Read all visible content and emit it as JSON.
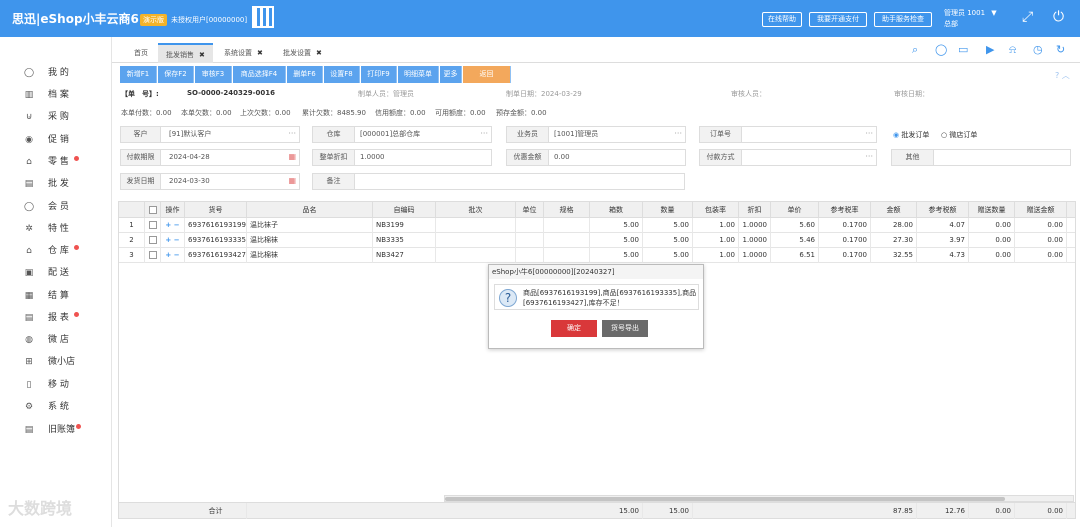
{
  "header": {
    "brand": "思迅|eShop小丰云商6",
    "demo_badge": "演示版",
    "unauth": "未授权用户[00000000]",
    "buttons": [
      "在线帮助",
      "我要开通支付",
      "助手服务检查"
    ],
    "user_line1": "管理员 1001",
    "user_line2": "总部",
    "user_arrow": "▼"
  },
  "sidebar": {
    "items": [
      "我 的",
      "档 案",
      "采 购",
      "促 销",
      "零 售",
      "批 发",
      "会 员",
      "特 性",
      "仓 库",
      "配 送",
      "结 算",
      "报 表",
      "微 店",
      "微小店",
      "移 动",
      "系 统",
      "旧账簿"
    ]
  },
  "tabs": [
    "首页",
    "批发销售",
    "系统设置",
    "批发设置"
  ],
  "toolbar": [
    "新增F1",
    "保存F2",
    "审核F3",
    "商品选择F4",
    "删单F6",
    "设置F8",
    "打印F9",
    "明细菜单",
    "更多",
    "返回"
  ],
  "doc": {
    "no_label": "【单　号】:",
    "no_value": "SO-0000-240329-0016",
    "maker": "制单人员：管理员",
    "date": "制单日期：2024-03-29",
    "auditor": "审核人员：",
    "audit_date": "审核日期："
  },
  "summary": [
    "本单付数：0.00",
    "本单欠数：0.00",
    "上次欠数：0.00",
    "累计欠数：8485.90",
    "信用额度：0.00",
    "可用额度：0.00",
    "预存金额：0.00"
  ],
  "form": {
    "customer_label": "客户",
    "customer": "[91]默认客户",
    "warehouse_label": "仓库",
    "warehouse": "[000001]总部仓库",
    "salesman_label": "业务员",
    "salesman": "[1001]管理员",
    "order_label": "订单号",
    "order": "",
    "payterm_label": "付款期限",
    "payterm": "2024-04-28",
    "discount_label": "整单折扣",
    "discount": "1.0000",
    "promo_label": "优惠金额",
    "promo": "0.00",
    "paymethod_label": "付款方式",
    "paymethod": "",
    "other_label": "其他",
    "other": "",
    "ship_label": "发货日期",
    "ship": "2024-03-30",
    "remark_label": "备注",
    "remark": "",
    "radio1": "批发订单",
    "radio2": "微店订单"
  },
  "table": {
    "headers": [
      "",
      "操作",
      "货号",
      "品名",
      "自编码",
      "批次",
      "单位",
      "规格",
      "箱数",
      "数量",
      "包装率",
      "折扣",
      "单价",
      "参考税率",
      "金额",
      "参考税额",
      "赠送数量",
      "赠送金额"
    ],
    "rows": [
      [
        "1",
        "6937616193199",
        "温比袜子",
        "NB3199",
        "",
        "",
        "",
        "5.00",
        "5.00",
        "1.00",
        "1.0000",
        "5.60",
        "0.1700",
        "28.00",
        "4.07",
        "0.00",
        "0.00"
      ],
      [
        "2",
        "6937616193335",
        "温比棉袜",
        "NB3335",
        "",
        "",
        "",
        "5.00",
        "5.00",
        "1.00",
        "1.0000",
        "5.46",
        "0.1700",
        "27.30",
        "3.97",
        "0.00",
        "0.00"
      ],
      [
        "3",
        "6937616193427",
        "温比棉袜",
        "NB3427",
        "",
        "",
        "",
        "5.00",
        "5.00",
        "1.00",
        "1.0000",
        "6.51",
        "0.1700",
        "32.55",
        "4.73",
        "0.00",
        "0.00"
      ]
    ],
    "footer": {
      "label": "合计",
      "boxes": "15.00",
      "qty": "15.00",
      "amount": "87.85",
      "tax": "12.76",
      "gift_qty": "0.00",
      "gift_amt": "0.00"
    }
  },
  "dialog": {
    "title": "eShop小牛6[00000000][20240327]",
    "message": "商品[6937616193199],商品[6937616193335],商品[6937616193427],库存不足！",
    "ok": "确定",
    "export": "货号导出"
  },
  "watermark": "大数跨境"
}
